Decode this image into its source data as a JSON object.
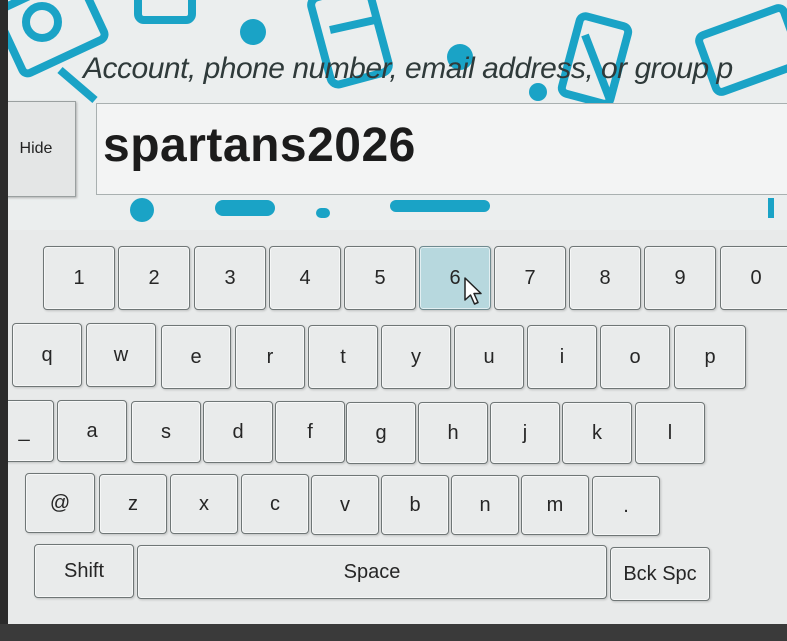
{
  "prompt": "Account, phone number, email address, or group p",
  "hide_button": "Hide",
  "input_value": "spartans2026",
  "keys": {
    "row1": [
      "1",
      "2",
      "3",
      "4",
      "5",
      "6",
      "7",
      "8",
      "9",
      "0"
    ],
    "row2": [
      "q",
      "w",
      "e",
      "r",
      "t",
      "y",
      "u",
      "i",
      "o",
      "p"
    ],
    "row3": [
      "_",
      "a",
      "s",
      "d",
      "f",
      "g",
      "h",
      "j",
      "k",
      "l"
    ],
    "row4": [
      "@",
      "z",
      "x",
      "c",
      "v",
      "b",
      "n",
      "m",
      "."
    ],
    "shift": "Shift",
    "space": "Space",
    "backspace": "Bck Spc"
  },
  "active_key": "6",
  "colors": {
    "accent": "#1aa3c6",
    "active_key": "#b7d8de",
    "key_bg": "#e9ebeb"
  },
  "icons": [
    "mouse-pointer-icon"
  ]
}
